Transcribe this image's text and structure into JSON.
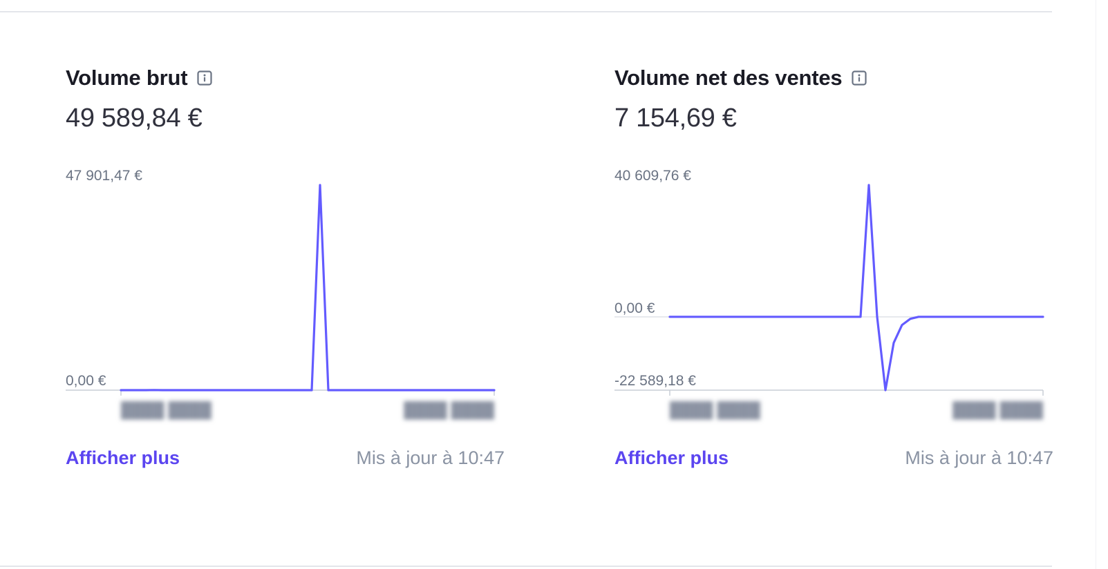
{
  "accent_color": "#635bff",
  "cards": [
    {
      "title": "Volume brut",
      "info_icon": "info-icon",
      "value": "49 589,84 €",
      "more_label": "Afficher plus",
      "updated_label": "Mis à jour à 10:47",
      "chart_data": {
        "type": "line",
        "y_tick_labels": [
          "47 901,47 €",
          "0,00 €"
        ],
        "ylim": [
          0,
          47901.47
        ],
        "x_tick_labels_blurred": true,
        "values": [
          0,
          0,
          0,
          0,
          30,
          0,
          0,
          0,
          0,
          0,
          0,
          0,
          0,
          0,
          0,
          0,
          0,
          0,
          0,
          0,
          0,
          0,
          0,
          0,
          47901.47,
          0,
          0,
          0,
          0,
          0,
          0,
          0,
          0,
          0,
          0,
          0,
          0,
          0,
          0,
          0,
          0,
          0,
          0,
          0,
          0,
          0
        ]
      }
    },
    {
      "title": "Volume net des ventes",
      "info_icon": "info-icon",
      "value": "7 154,69 €",
      "more_label": "Afficher plus",
      "updated_label": "Mis à jour à 10:47",
      "chart_data": {
        "type": "line",
        "y_tick_labels": [
          "40 609,76 €",
          "0,00 €",
          "-22 589,18 €"
        ],
        "ylim": [
          -22589.18,
          40609.76
        ],
        "x_tick_labels_blurred": true,
        "values": [
          0,
          0,
          0,
          0,
          0,
          0,
          0,
          0,
          0,
          0,
          0,
          0,
          0,
          0,
          0,
          0,
          0,
          0,
          0,
          0,
          0,
          0,
          0,
          0,
          40609.76,
          0,
          -22589.18,
          -8000,
          -2500,
          -600,
          0,
          0,
          0,
          0,
          0,
          0,
          0,
          0,
          0,
          0,
          0,
          0,
          0,
          0,
          0,
          0
        ]
      }
    }
  ]
}
